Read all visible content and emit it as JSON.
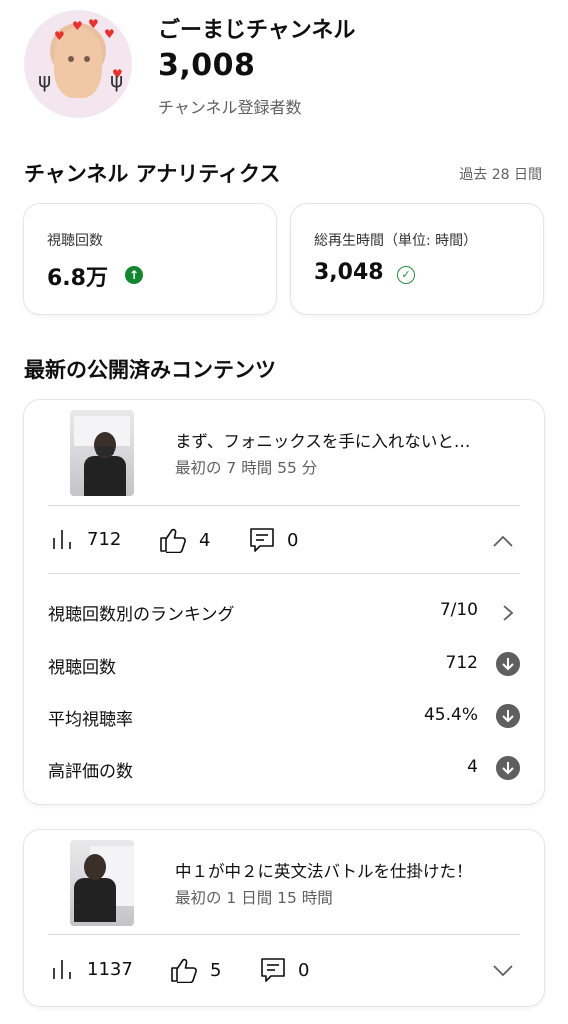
{
  "channel": {
    "name": "ごーまじチャンネル",
    "subscriber_count": "3,008",
    "subscriber_label": "チャンネル登録者数"
  },
  "analytics": {
    "title": "チャンネル アナリティクス",
    "period": "過去 28 日間",
    "cards": [
      {
        "label": "視聴回数",
        "value": "6.8万",
        "indicator": "arrow-up-circle-icon",
        "indicator_color": "#12872f"
      },
      {
        "label": "総再生時間（単位: 時間）",
        "value": "3,048",
        "indicator": "check-circle-icon",
        "indicator_color": "#2c8a3e"
      }
    ]
  },
  "latest": {
    "title": "最新の公開済みコンテンツ",
    "items": [
      {
        "title": "まず、フォニックスを手に入れないと…",
        "subtitle": "最初の 7 時間 55 分",
        "views": "712",
        "likes": "4",
        "comments": "0",
        "expanded": true,
        "details": [
          {
            "label": "視聴回数別のランキング",
            "value": "7/10",
            "icon": "chevron-right-icon"
          },
          {
            "label": "視聴回数",
            "value": "712",
            "icon": "arrow-down-circle-icon"
          },
          {
            "label": "平均視聴率",
            "value": "45.4%",
            "icon": "arrow-down-circle-icon"
          },
          {
            "label": "高評価の数",
            "value": "4",
            "icon": "arrow-down-circle-icon"
          }
        ]
      },
      {
        "title": "中１が中２に英文法バトルを仕掛けた！",
        "subtitle": "最初の 1 日間 15 時間",
        "views": "1137",
        "likes": "5",
        "comments": "0",
        "expanded": false
      }
    ]
  },
  "colors": {
    "text_primary": "#0f0f0f",
    "text_secondary": "#606060",
    "positive_green": "#12872f",
    "icon_gray": "#5f5f5f"
  }
}
